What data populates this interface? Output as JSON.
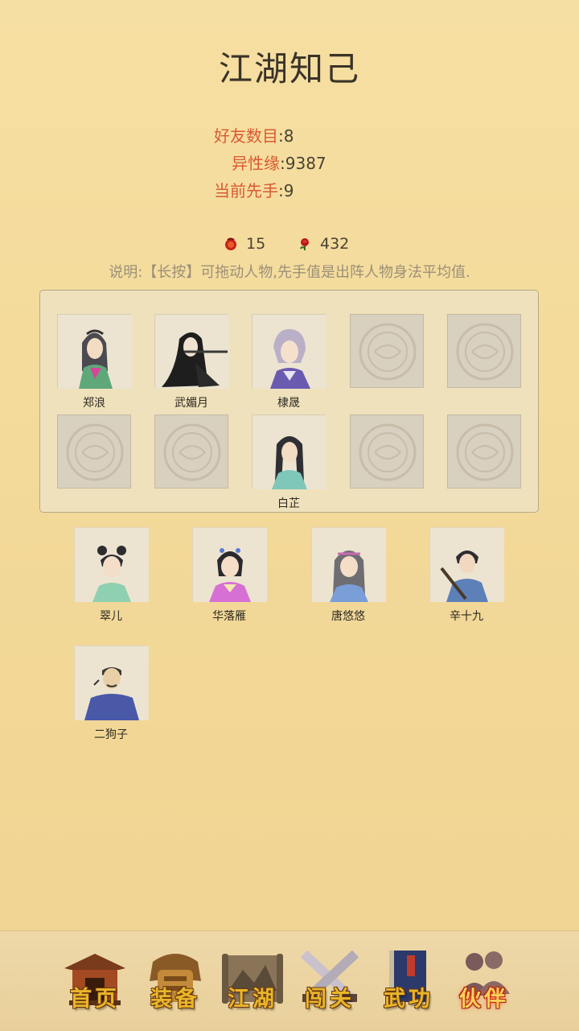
{
  "header": {
    "title": "江湖知己"
  },
  "stats": [
    {
      "label": "好友数目",
      "value": "8"
    },
    {
      "label": "异性缘",
      "value": "9387"
    },
    {
      "label": "当前先手",
      "value": "9"
    }
  ],
  "resources": {
    "item1": {
      "icon": "red-pouch-icon",
      "count": "15"
    },
    "item2": {
      "icon": "red-rose-icon",
      "count": "432"
    }
  },
  "note": "说明:【长按】可拖动人物,先手值是出阵人物身法平均值.",
  "team": {
    "slots": [
      {
        "name": "郑浪",
        "portrait": "woman-green-robe"
      },
      {
        "name": "武媚月",
        "portrait": "woman-black-hair-flute"
      },
      {
        "name": "棣晟",
        "portrait": "man-white-hair-purple"
      },
      {
        "name": "",
        "portrait": "empty-emblem"
      },
      {
        "name": "",
        "portrait": "empty-emblem"
      },
      {
        "name": "",
        "portrait": "empty-emblem"
      },
      {
        "name": "",
        "portrait": "empty-emblem"
      },
      {
        "name": "白芷",
        "portrait": "woman-teal-robe"
      },
      {
        "name": "",
        "portrait": "empty-emblem"
      },
      {
        "name": "",
        "portrait": "empty-emblem"
      }
    ]
  },
  "bench": [
    {
      "name": "翠儿",
      "portrait": "girl-green-buns"
    },
    {
      "name": "华落雁",
      "portrait": "woman-pink-robe"
    },
    {
      "name": "唐悠悠",
      "portrait": "woman-blue-headband"
    },
    {
      "name": "辛十九",
      "portrait": "man-blue-sword"
    },
    {
      "name": "二狗子",
      "portrait": "man-bald-blue"
    }
  ],
  "nav": [
    {
      "label": "首页",
      "icon": "home-temple-icon",
      "active": false
    },
    {
      "label": "装备",
      "icon": "armor-icon",
      "active": false
    },
    {
      "label": "江湖",
      "icon": "map-scroll-icon",
      "active": false
    },
    {
      "label": "闯关",
      "icon": "crossed-swords-icon",
      "active": false
    },
    {
      "label": "武功",
      "icon": "book-icon",
      "active": false
    },
    {
      "label": "伙伴",
      "icon": "companions-icon",
      "active": true
    }
  ],
  "colors": {
    "background": "#f3d999",
    "stat_label": "#d95a33",
    "nav_label": "#e9b52a",
    "panel": "#efe1bb"
  }
}
